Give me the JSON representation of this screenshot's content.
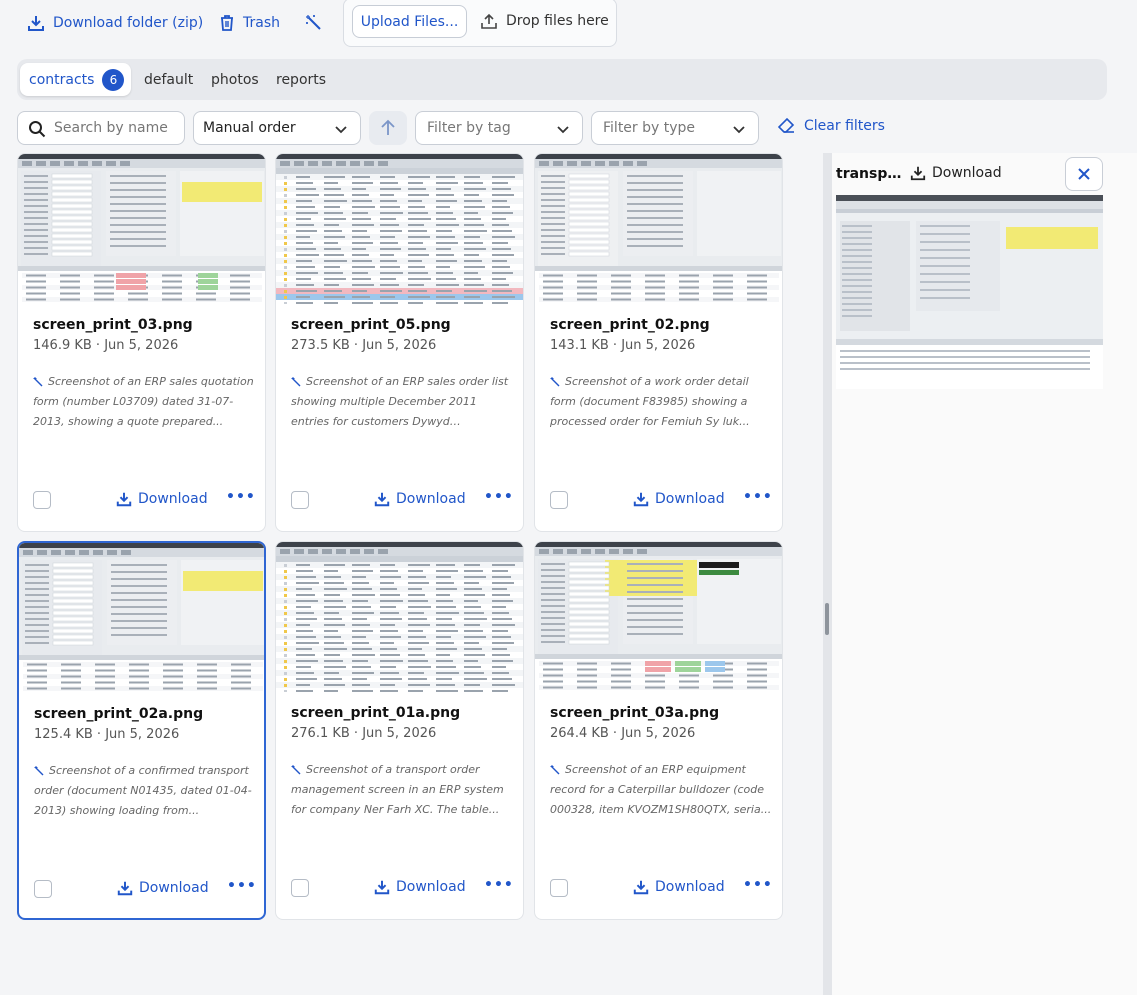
{
  "toolbar": {
    "download_folder": "Download folder (zip)",
    "trash": "Trash",
    "upload": "Upload Files...",
    "drop": "Drop files here"
  },
  "tabs": [
    {
      "label": "contracts",
      "count": "6",
      "active": true
    },
    {
      "label": "default"
    },
    {
      "label": "photos"
    },
    {
      "label": "reports"
    }
  ],
  "filters": {
    "search_placeholder": "Search by name",
    "order": "Manual order",
    "tag_placeholder": "Filter by tag",
    "type_placeholder": "Filter by type",
    "clear": "Clear filters"
  },
  "cards": [
    {
      "name": "screen_print_03.png",
      "meta": "146.9 KB · Jun 5, 2026",
      "desc": "Screenshot of an ERP sales quotation form (number L03709) dated 31-07-2013, showing a quote prepared...",
      "download": "Download"
    },
    {
      "name": "screen_print_05.png",
      "meta": "273.5 KB · Jun 5, 2026",
      "desc": "Screenshot of an ERP sales order list showing multiple December 2011 entries for customers Dywyd Dwuriguz...",
      "download": "Download"
    },
    {
      "name": "screen_print_02.png",
      "meta": "143.1 KB · Jun 5, 2026",
      "desc": "Screenshot of a work order detail form (document F83985) showing a processed order for Femiuh Sy luk...",
      "download": "Download"
    },
    {
      "name": "screen_print_02a.png",
      "meta": "125.4 KB · Jun 5, 2026",
      "desc": "Screenshot of a confirmed transport order (document N01435, dated 01-04-2013) showing loading from...",
      "download": "Download"
    },
    {
      "name": "screen_print_01a.png",
      "meta": "276.1 KB · Jun 5, 2026",
      "desc": "Screenshot of a transport order management screen in an ERP system for company Ner Farh XC. The table...",
      "download": "Download"
    },
    {
      "name": "screen_print_03a.png",
      "meta": "264.4 KB · Jun 5, 2026",
      "desc": "Screenshot of an ERP equipment record for a Caterpillar bulldozer (code 000328, item KVOZM1SH80QTX, seria...",
      "download": "Download"
    }
  ],
  "panel": {
    "title": "transpo...",
    "download": "Download"
  },
  "colors": {
    "accent": "#2156c9",
    "selected_border": "#2f66d3"
  }
}
